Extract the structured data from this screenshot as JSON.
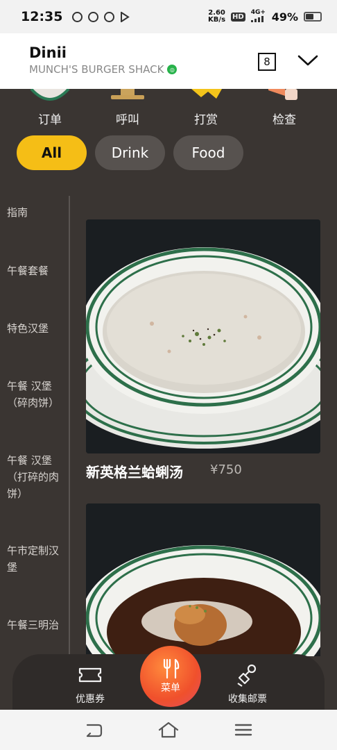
{
  "status_bar": {
    "time": "12:35",
    "net_speed_value": "2.60",
    "net_speed_unit": "KB/s",
    "hd_label": "HD",
    "network_label": "4G+",
    "battery_percent": "49%",
    "battery_level": 0.49
  },
  "header": {
    "title": "Dinii",
    "shop_name": "MUNCH'S BURGER SHACK",
    "table_number": "8"
  },
  "actions": [
    {
      "label": "订单",
      "icon": "order-clock-icon"
    },
    {
      "label": "呼叫",
      "icon": "bell-icon"
    },
    {
      "label": "打赏",
      "icon": "tip-hand-icon"
    },
    {
      "label": "检查",
      "icon": "check-receipt-icon"
    }
  ],
  "filters": [
    {
      "label": "All",
      "active": true
    },
    {
      "label": "Drink",
      "active": false
    },
    {
      "label": "Food",
      "active": false
    }
  ],
  "sidebar": {
    "items": [
      {
        "label": "指南"
      },
      {
        "label": "午餐套餐"
      },
      {
        "label": "特色汉堡"
      },
      {
        "label": "午餐 汉堡（碎肉饼）"
      },
      {
        "label": "午餐 汉堡（打碎的肉饼）"
      },
      {
        "label": "午市定制汉堡"
      },
      {
        "label": "午餐三明治"
      }
    ]
  },
  "menu_items": [
    {
      "name": "新英格兰蛤蜊汤",
      "price": "¥750",
      "image": "clam-chowder-photo"
    },
    {
      "name": "",
      "price": "",
      "image": "stew-bowl-photo"
    }
  ],
  "bottom_nav": {
    "coupon_label": "优惠券",
    "menu_label": "菜单",
    "stamp_label": "收集邮票"
  },
  "colors": {
    "background": "#3a3532",
    "accent_yellow": "#f5be16",
    "chip_inactive": "#57524f",
    "fab_orange": "#f0502c",
    "verified_green": "#27b24a"
  }
}
